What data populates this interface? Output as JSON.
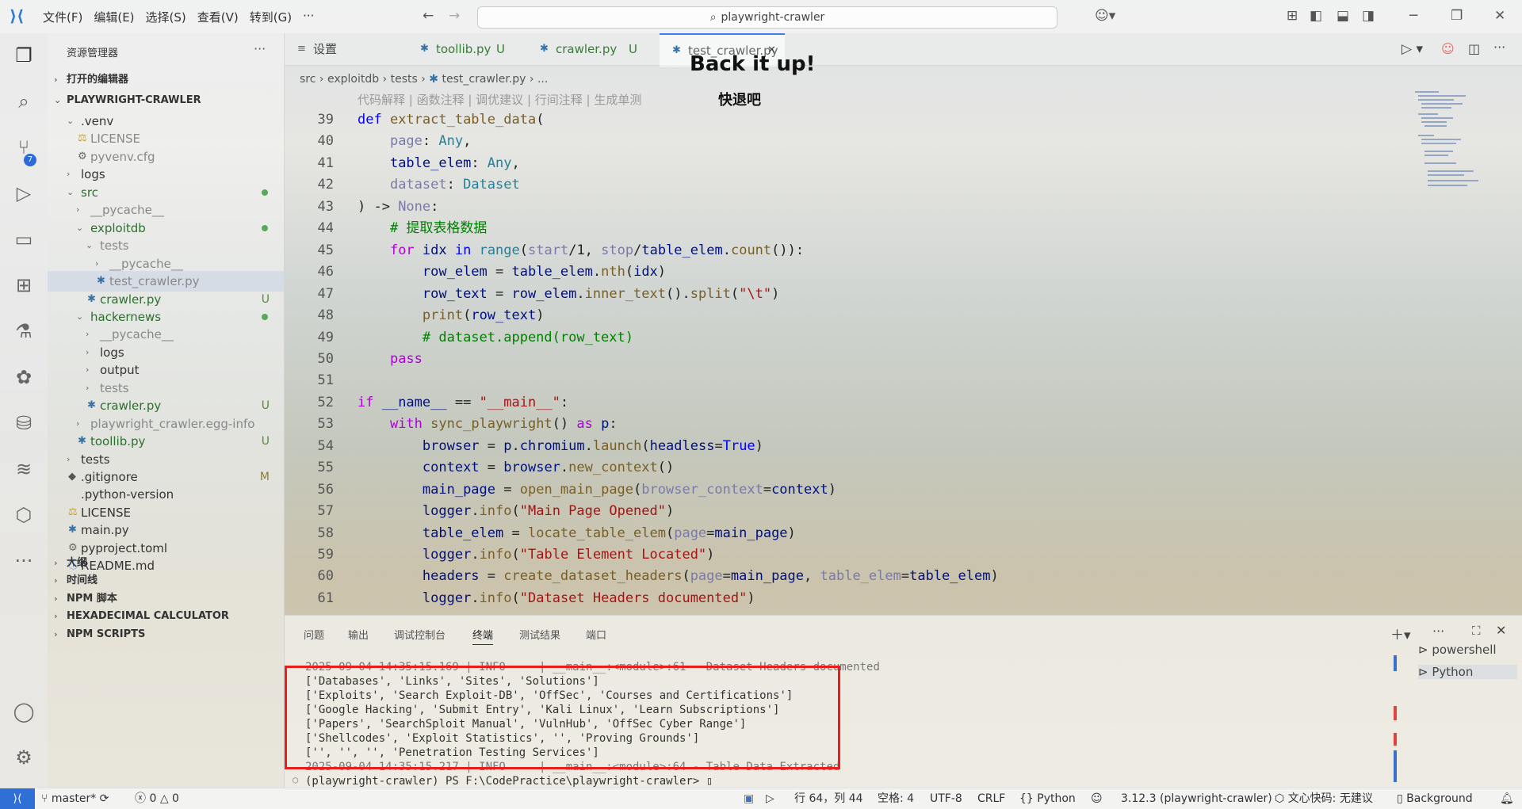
{
  "titlebar": {
    "menus": [
      "文件(F)",
      "编辑(E)",
      "选择(S)",
      "查看(V)",
      "转到(G)",
      "···"
    ],
    "search_text": "playwright-crawler"
  },
  "activity": {
    "scm_badge": "7"
  },
  "sidebar": {
    "title": "资源管理器",
    "more": "···",
    "open_editors": "打开的编辑器",
    "project": "PLAYWRIGHT-CRAWLER",
    "tree": [
      {
        "label": ".venv",
        "depth": 1,
        "twisty": "open"
      },
      {
        "label": "LICENSE",
        "depth": 2,
        "icon": "license",
        "dim": true
      },
      {
        "label": "pyvenv.cfg",
        "depth": 2,
        "icon": "gear",
        "dim": true
      },
      {
        "label": "logs",
        "depth": 1,
        "twisty": "closed"
      },
      {
        "label": "src",
        "depth": 1,
        "twisty": "open",
        "green": true,
        "dot": true
      },
      {
        "label": "__pycache__",
        "depth": 2,
        "twisty": "closed",
        "dim": true
      },
      {
        "label": "exploitdb",
        "depth": 2,
        "twisty": "open",
        "green": true,
        "dot": true
      },
      {
        "label": "tests",
        "depth": 3,
        "twisty": "open",
        "dim": true
      },
      {
        "label": "__pycache__",
        "depth": 4,
        "twisty": "closed",
        "dim": true
      },
      {
        "label": "test_crawler.py",
        "depth": 4,
        "icon": "py",
        "dim": true,
        "selected": true
      },
      {
        "label": "crawler.py",
        "depth": 3,
        "icon": "py",
        "green": true,
        "status": "U"
      },
      {
        "label": "hackernews",
        "depth": 2,
        "twisty": "open",
        "green": true,
        "dot": true
      },
      {
        "label": "__pycache__",
        "depth": 3,
        "twisty": "closed",
        "dim": true
      },
      {
        "label": "logs",
        "depth": 3,
        "twisty": "closed"
      },
      {
        "label": "output",
        "depth": 3,
        "twisty": "closed"
      },
      {
        "label": "tests",
        "depth": 3,
        "twisty": "closed",
        "dim": true
      },
      {
        "label": "crawler.py",
        "depth": 3,
        "icon": "py",
        "green": true,
        "status": "U"
      },
      {
        "label": "playwright_crawler.egg-info",
        "depth": 2,
        "twisty": "closed",
        "dim": true
      },
      {
        "label": "toollib.py",
        "depth": 2,
        "icon": "py",
        "green": true,
        "status": "U"
      },
      {
        "label": "tests",
        "depth": 1,
        "twisty": "closed"
      },
      {
        "label": ".gitignore",
        "depth": 1,
        "icon": "git",
        "status": "M"
      },
      {
        "label": ".python-version",
        "depth": 1,
        "icon": "none"
      },
      {
        "label": "LICENSE",
        "depth": 1,
        "icon": "license"
      },
      {
        "label": "main.py",
        "depth": 1,
        "icon": "py"
      },
      {
        "label": "pyproject.toml",
        "depth": 1,
        "icon": "gear"
      },
      {
        "label": "README.md",
        "depth": 1,
        "icon": "info"
      }
    ],
    "sections": [
      "大纲",
      "时间线",
      "NPM 脚本",
      "HEXADECIMAL CALCULATOR",
      "NPM SCRIPTS"
    ]
  },
  "tabs": [
    {
      "label": "设置",
      "icon": "≡",
      "status": ""
    },
    {
      "label": "toollib.py",
      "icon": "py",
      "status": "U"
    },
    {
      "label": "crawler.py",
      "icon": "py",
      "status": "U"
    },
    {
      "label": "test_crawler.py",
      "icon": "py",
      "status": "",
      "active": true
    }
  ],
  "breadcrumb": [
    "src",
    "exploitdb",
    "tests",
    "test_crawler.py",
    "..."
  ],
  "codelens": "代码解释 | 函数注释 | 调优建议 | 行间注释 | 生成单测",
  "overlay": {
    "title": "Back it up!",
    "subtitle": "快退吧"
  },
  "code": [
    {
      "n": "39",
      "t": [
        [
          "kw",
          "def "
        ],
        [
          "fn",
          "extract_table_data"
        ],
        [
          "pl",
          "("
        ]
      ]
    },
    {
      "n": "40",
      "t": [
        [
          "pl",
          "    "
        ],
        [
          "pm",
          "page"
        ],
        [
          "pl",
          ": "
        ],
        [
          "ty",
          "Any"
        ],
        [
          "pl",
          ","
        ]
      ]
    },
    {
      "n": "41",
      "t": [
        [
          "pl",
          "    "
        ],
        [
          "vr",
          "table_elem"
        ],
        [
          "pl",
          ": "
        ],
        [
          "ty",
          "Any"
        ],
        [
          "pl",
          ","
        ]
      ]
    },
    {
      "n": "42",
      "t": [
        [
          "pl",
          "    "
        ],
        [
          "pm",
          "dataset"
        ],
        [
          "pl",
          ": "
        ],
        [
          "ty",
          "Dataset"
        ]
      ]
    },
    {
      "n": "43",
      "t": [
        [
          "pl",
          ") -> "
        ],
        [
          "pm",
          "None"
        ],
        [
          "pl",
          ":"
        ]
      ]
    },
    {
      "n": "44",
      "t": [
        [
          "pl",
          "    "
        ],
        [
          "cm",
          "# 提取表格数据"
        ]
      ]
    },
    {
      "n": "45",
      "t": [
        [
          "pl",
          "    "
        ],
        [
          "kw2",
          "for "
        ],
        [
          "vr",
          "idx "
        ],
        [
          "kw",
          "in "
        ],
        [
          "ty",
          "range"
        ],
        [
          "pl",
          "("
        ],
        [
          "pm",
          "start"
        ],
        [
          "pl",
          "/1, "
        ],
        [
          "pm",
          "stop"
        ],
        [
          "pl",
          "/"
        ],
        [
          "vr",
          "table_elem"
        ],
        [
          "pl",
          "."
        ],
        [
          "fn",
          "count"
        ],
        [
          "pl",
          "()):"
        ]
      ]
    },
    {
      "n": "46",
      "t": [
        [
          "pl",
          "        "
        ],
        [
          "vr",
          "row_elem"
        ],
        [
          "pl",
          " = "
        ],
        [
          "vr",
          "table_elem"
        ],
        [
          "pl",
          "."
        ],
        [
          "fn",
          "nth"
        ],
        [
          "pl",
          "("
        ],
        [
          "vr",
          "idx"
        ],
        [
          "pl",
          ")"
        ]
      ]
    },
    {
      "n": "47",
      "t": [
        [
          "pl",
          "        "
        ],
        [
          "vr",
          "row_text"
        ],
        [
          "pl",
          " = "
        ],
        [
          "vr",
          "row_elem"
        ],
        [
          "pl",
          "."
        ],
        [
          "fn",
          "inner_text"
        ],
        [
          "pl",
          "()."
        ],
        [
          "fn",
          "split"
        ],
        [
          "pl",
          "("
        ],
        [
          "str",
          "\"\\t\""
        ],
        [
          "pl",
          ")"
        ]
      ]
    },
    {
      "n": "48",
      "t": [
        [
          "pl",
          "        "
        ],
        [
          "fn",
          "print"
        ],
        [
          "pl",
          "("
        ],
        [
          "vr",
          "row_text"
        ],
        [
          "pl",
          ")"
        ]
      ]
    },
    {
      "n": "49",
      "t": [
        [
          "pl",
          "        "
        ],
        [
          "cm",
          "# dataset.append(row_text)"
        ]
      ]
    },
    {
      "n": "50",
      "t": [
        [
          "pl",
          "    "
        ],
        [
          "kw2",
          "pass"
        ]
      ]
    },
    {
      "n": "51",
      "t": [
        [
          "pl",
          ""
        ]
      ]
    },
    {
      "n": "52",
      "t": [
        [
          "kw2",
          "if "
        ],
        [
          "vr",
          "__name__"
        ],
        [
          "pl",
          " == "
        ],
        [
          "str",
          "\"__main__\""
        ],
        [
          "pl",
          ":"
        ]
      ]
    },
    {
      "n": "53",
      "t": [
        [
          "pl",
          "    "
        ],
        [
          "kw2",
          "with "
        ],
        [
          "fn",
          "sync_playwright"
        ],
        [
          "pl",
          "() "
        ],
        [
          "kw2",
          "as "
        ],
        [
          "vr",
          "p"
        ],
        [
          "pl",
          ":"
        ]
      ]
    },
    {
      "n": "54",
      "t": [
        [
          "pl",
          "        "
        ],
        [
          "vr",
          "browser"
        ],
        [
          "pl",
          " = "
        ],
        [
          "vr",
          "p"
        ],
        [
          "pl",
          "."
        ],
        [
          "vr",
          "chromium"
        ],
        [
          "pl",
          "."
        ],
        [
          "fn",
          "launch"
        ],
        [
          "pl",
          "("
        ],
        [
          "vr",
          "headless"
        ],
        [
          "pl",
          "="
        ],
        [
          "kw",
          "True"
        ],
        [
          "pl",
          ")"
        ]
      ]
    },
    {
      "n": "55",
      "t": [
        [
          "pl",
          "        "
        ],
        [
          "vr",
          "context"
        ],
        [
          "pl",
          " = "
        ],
        [
          "vr",
          "browser"
        ],
        [
          "pl",
          "."
        ],
        [
          "fn",
          "new_context"
        ],
        [
          "pl",
          "()"
        ]
      ]
    },
    {
      "n": "56",
      "t": [
        [
          "pl",
          "        "
        ],
        [
          "vr",
          "main_page"
        ],
        [
          "pl",
          " = "
        ],
        [
          "fn",
          "open_main_page"
        ],
        [
          "pl",
          "("
        ],
        [
          "pm",
          "browser_context"
        ],
        [
          "pl",
          "="
        ],
        [
          "vr",
          "context"
        ],
        [
          "pl",
          ")"
        ]
      ]
    },
    {
      "n": "57",
      "t": [
        [
          "pl",
          "        "
        ],
        [
          "vr",
          "logger"
        ],
        [
          "pl",
          "."
        ],
        [
          "fn",
          "info"
        ],
        [
          "pl",
          "("
        ],
        [
          "str",
          "\"Main Page Opened\""
        ],
        [
          "pl",
          ")"
        ]
      ]
    },
    {
      "n": "58",
      "t": [
        [
          "pl",
          "        "
        ],
        [
          "vr",
          "table_elem"
        ],
        [
          "pl",
          " = "
        ],
        [
          "fn",
          "locate_table_elem"
        ],
        [
          "pl",
          "("
        ],
        [
          "pm",
          "page"
        ],
        [
          "pl",
          "="
        ],
        [
          "vr",
          "main_page"
        ],
        [
          "pl",
          ")"
        ]
      ]
    },
    {
      "n": "59",
      "t": [
        [
          "pl",
          "        "
        ],
        [
          "vr",
          "logger"
        ],
        [
          "pl",
          "."
        ],
        [
          "fn",
          "info"
        ],
        [
          "pl",
          "("
        ],
        [
          "str",
          "\"Table Element Located\""
        ],
        [
          "pl",
          ")"
        ]
      ]
    },
    {
      "n": "60",
      "t": [
        [
          "pl",
          "        "
        ],
        [
          "vr",
          "headers"
        ],
        [
          "pl",
          " = "
        ],
        [
          "fn",
          "create_dataset_headers"
        ],
        [
          "pl",
          "("
        ],
        [
          "pm",
          "page"
        ],
        [
          "pl",
          "="
        ],
        [
          "vr",
          "main_page"
        ],
        [
          "pl",
          ", "
        ],
        [
          "pm",
          "table_elem"
        ],
        [
          "pl",
          "="
        ],
        [
          "vr",
          "table_elem"
        ],
        [
          "pl",
          ")"
        ]
      ]
    },
    {
      "n": "61",
      "t": [
        [
          "pl",
          "        "
        ],
        [
          "vr",
          "logger"
        ],
        [
          "pl",
          "."
        ],
        [
          "fn",
          "info"
        ],
        [
          "pl",
          "("
        ],
        [
          "str",
          "\"Dataset Headers documented\""
        ],
        [
          "pl",
          ")"
        ]
      ]
    }
  ],
  "panel": {
    "tabs": [
      "问题",
      "输出",
      "调试控制台",
      "终端",
      "测试结果",
      "端口"
    ],
    "active_tab": "终端",
    "terminal_lines": [
      "2025-09-04 14:35:15.169 | INFO     | __main__:<module>:61 - Dataset Headers documented",
      "['Databases', 'Links', 'Sites', 'Solutions']",
      "['Exploits', 'Search Exploit-DB', 'OffSec', 'Courses and Certifications']",
      "['Google Hacking', 'Submit Entry', 'Kali Linux', 'Learn Subscriptions']",
      "['Papers', 'SearchSploit Manual', 'VulnHub', 'OffSec Cyber Range']",
      "['Shellcodes', 'Exploit Statistics', '', 'Proving Grounds']",
      "['', '', '', 'Penetration Testing Services']",
      "2025-09-04 14:35:15.217 | INFO     | __main__:<module>:64 - Table Data Extracted",
      "(playwright-crawler) PS F:\\CodePractice\\playwright-crawler> "
    ],
    "terminals": [
      "powershell",
      "Python"
    ]
  },
  "statusbar": {
    "branch": "master*",
    "errors": "0",
    "warnings": "0",
    "position": "行 64，列 44",
    "spaces": "空格: 4",
    "encoding": "UTF-8",
    "eol": "CRLF",
    "language": "Python",
    "interpreter": "3.12.3 (playwright-crawler)",
    "ai": "文心快码: 无建议",
    "background": "Background"
  }
}
